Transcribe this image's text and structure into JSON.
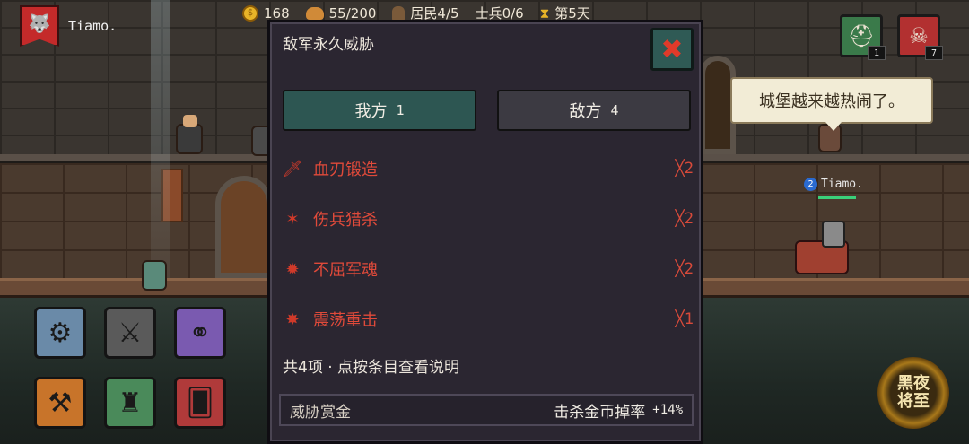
{
  "hud": {
    "player_name": "Tiamo.",
    "flag_icon": "wolf-emblem-icon",
    "gold": "168",
    "food": "55/200",
    "residents": "居民4/5",
    "soldiers": "士兵0/6",
    "day": "第5天",
    "helmet_badge": "1",
    "skull_badge": "7"
  },
  "speech_bubble": "城堡越来越热闹了。",
  "ally": {
    "number": "2",
    "name": "Tiamo."
  },
  "modal": {
    "title": "敌军永久威胁",
    "close_icon": "close-icon",
    "tabs": [
      {
        "label": "我方",
        "count": "1"
      },
      {
        "label": "敌方",
        "count": "4"
      }
    ],
    "effects": [
      {
        "name": "血刃锻造",
        "multiplier": "╳2",
        "icon": "blood-sword-icon"
      },
      {
        "name": "伤兵猎杀",
        "multiplier": "╳2",
        "icon": "blood-claw-icon"
      },
      {
        "name": "不屈军魂",
        "multiplier": "╳2",
        "icon": "red-spirit-icon"
      },
      {
        "name": "震荡重击",
        "multiplier": "╳1",
        "icon": "shock-hammer-icon"
      }
    ],
    "summary": "共4项 · 点按条目查看说明",
    "footer": {
      "label": "威胁赏金",
      "effect": "击杀金币掉率",
      "value": "+14%"
    }
  },
  "night_badge": {
    "line1": "黑夜",
    "line2": "将至"
  },
  "tools": [
    {
      "icon": "gear-icon"
    },
    {
      "icon": "crossed-swords-icon"
    },
    {
      "icon": "skill-tree-icon"
    },
    {
      "icon": "anvil-hammer-icon"
    },
    {
      "icon": "castle-tower-icon"
    },
    {
      "icon": "cards-icon"
    }
  ],
  "colors": {
    "modal_bg": "#2b2631",
    "tab_active": "#2d5652",
    "tab_inactive": "#3c3a42",
    "effect_red": "#e04a3a",
    "close_x": "#e03a2a"
  }
}
